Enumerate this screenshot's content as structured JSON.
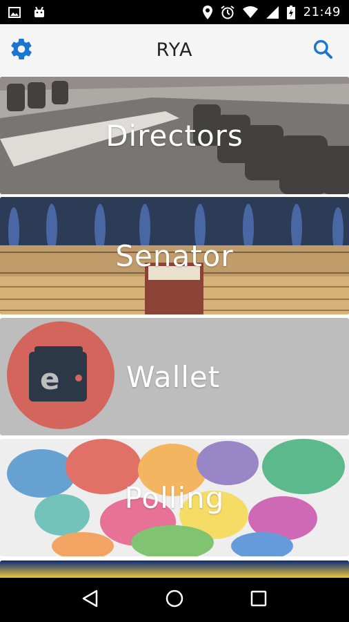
{
  "status_bar": {
    "time": "21:49",
    "icons": [
      "image-icon",
      "android-icon",
      "location-icon",
      "alarm-icon",
      "wifi-icon",
      "signal-icon",
      "battery-charging-icon"
    ]
  },
  "app_bar": {
    "title": "RYA",
    "left_icon": "gear-icon",
    "right_icon": "search-icon",
    "accent_color": "#1976d2"
  },
  "tiles": [
    {
      "label": "Directors"
    },
    {
      "label": "Senator"
    },
    {
      "label": "Wallet"
    },
    {
      "label": "Polling"
    }
  ],
  "nav_bar": {
    "buttons": [
      "back-icon",
      "home-icon",
      "recents-icon"
    ]
  }
}
